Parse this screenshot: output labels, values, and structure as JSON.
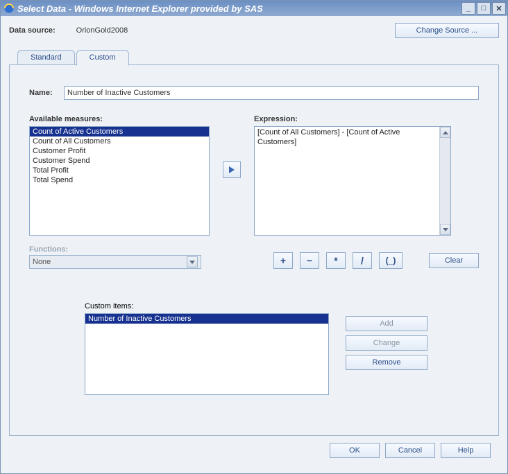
{
  "window": {
    "title": "Select Data - Windows Internet Explorer provided by SAS"
  },
  "header": {
    "data_source_label": "Data source:",
    "data_source_value": "OrionGold2008",
    "change_source": "Change Source ..."
  },
  "tabs": {
    "standard": "Standard",
    "custom": "Custom"
  },
  "form": {
    "name_label": "Name:",
    "name_value": "Number of Inactive Customers",
    "available_label": "Available measures:",
    "expression_label": "Expression:",
    "expression_value": "[Count of All Customers] - [Count of Active Customers]",
    "functions_label": "Functions:",
    "functions_value": "None",
    "custom_items_label": "Custom items:"
  },
  "measures": [
    "Count of Active Customers",
    "Count of All Customers",
    "Customer Profit",
    "Customer Spend",
    "Total Profit",
    "Total Spend"
  ],
  "custom_items": [
    "Number of Inactive Customers"
  ],
  "ops": {
    "plus": "+",
    "minus": "−",
    "times": "*",
    "div": "/",
    "paren": "(_)",
    "clear": "Clear"
  },
  "side_buttons": {
    "add": "Add",
    "change": "Change",
    "remove": "Remove"
  },
  "footer": {
    "ok": "OK",
    "cancel": "Cancel",
    "help": "Help"
  }
}
